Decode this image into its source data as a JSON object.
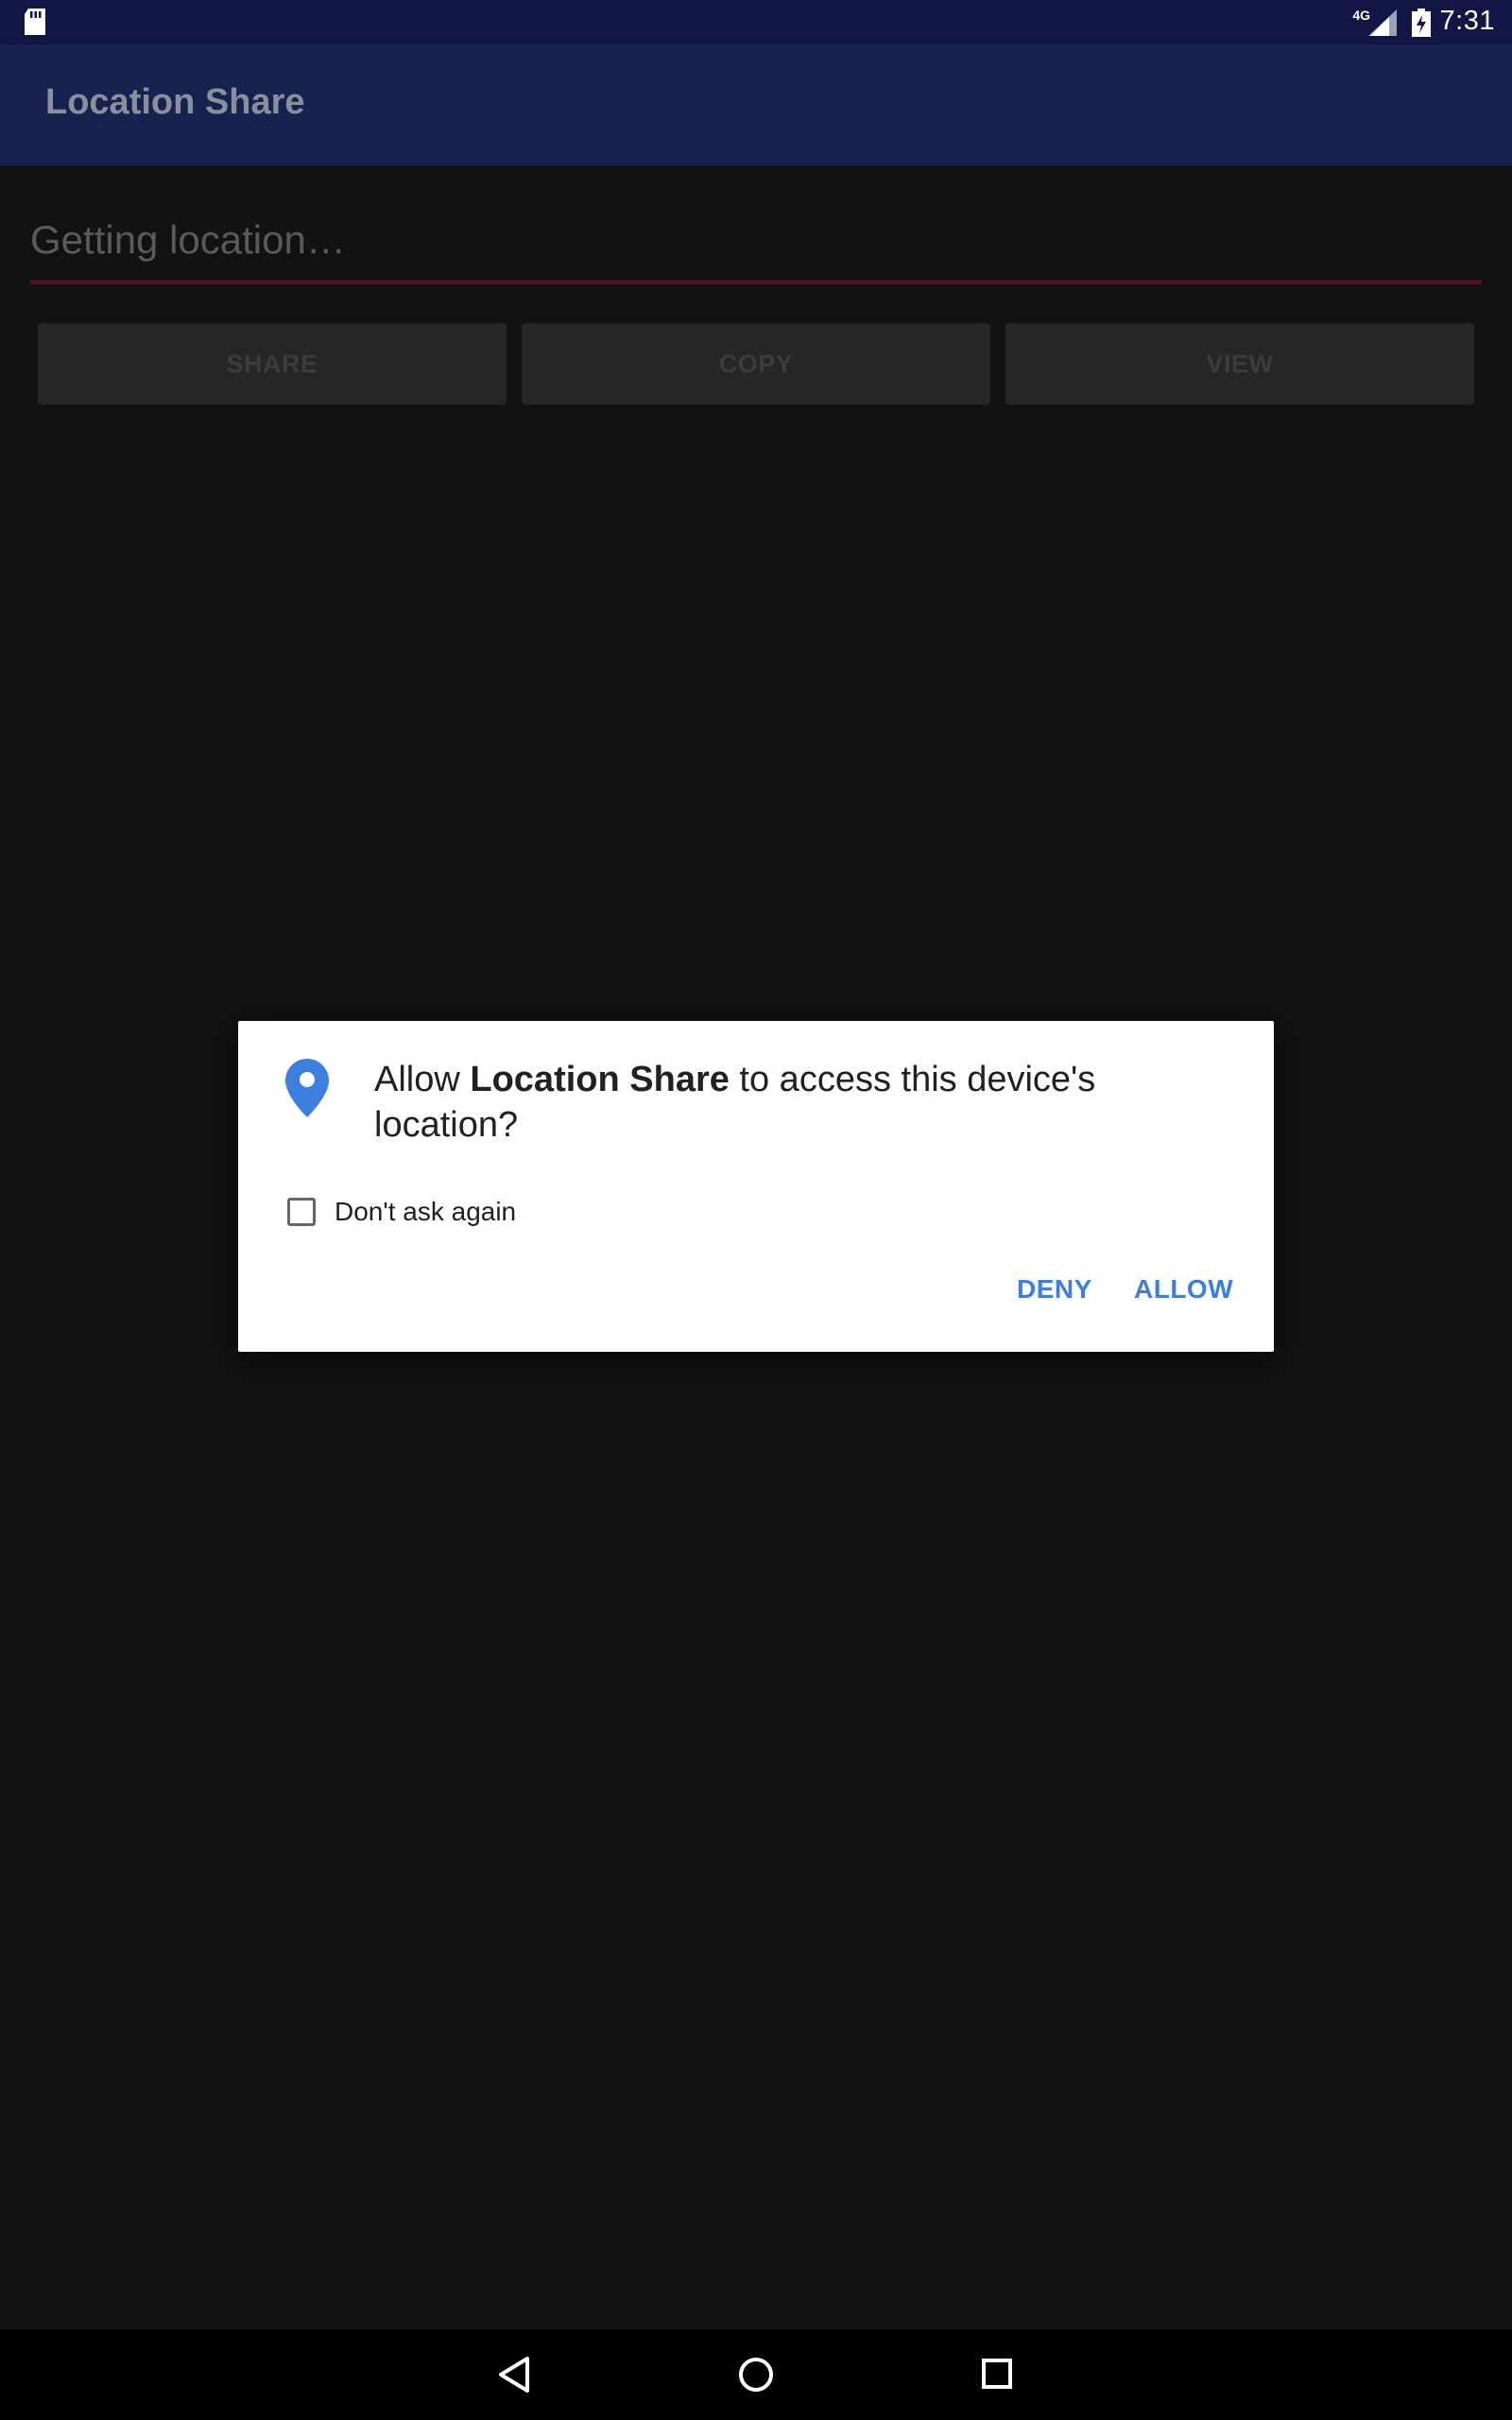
{
  "status_bar": {
    "network_type": "4G",
    "time": "7:31",
    "icons": [
      "sd-card-icon",
      "signal-icon",
      "battery-charging-icon"
    ]
  },
  "app_bar": {
    "title": "Location Share"
  },
  "main": {
    "location_text": "Getting location…",
    "buttons": {
      "share": "SHARE",
      "copy": "COPY",
      "view": "VIEW"
    }
  },
  "dialog": {
    "message_prefix": "Allow ",
    "app_name": "Location Share",
    "message_suffix": " to access this device's location?",
    "checkbox_label": "Don't ask again",
    "checkbox_checked": false,
    "deny_label": "DENY",
    "allow_label": "ALLOW",
    "icon": "location-pin-icon"
  },
  "nav_bar": {
    "icons": [
      "back-icon",
      "home-icon",
      "recents-icon"
    ]
  },
  "colors": {
    "status_bar": "#111645",
    "app_bar": "#17234f",
    "background": "#121212",
    "accent_blue": "#3d7fe0",
    "field_underline": "#4a1226"
  }
}
